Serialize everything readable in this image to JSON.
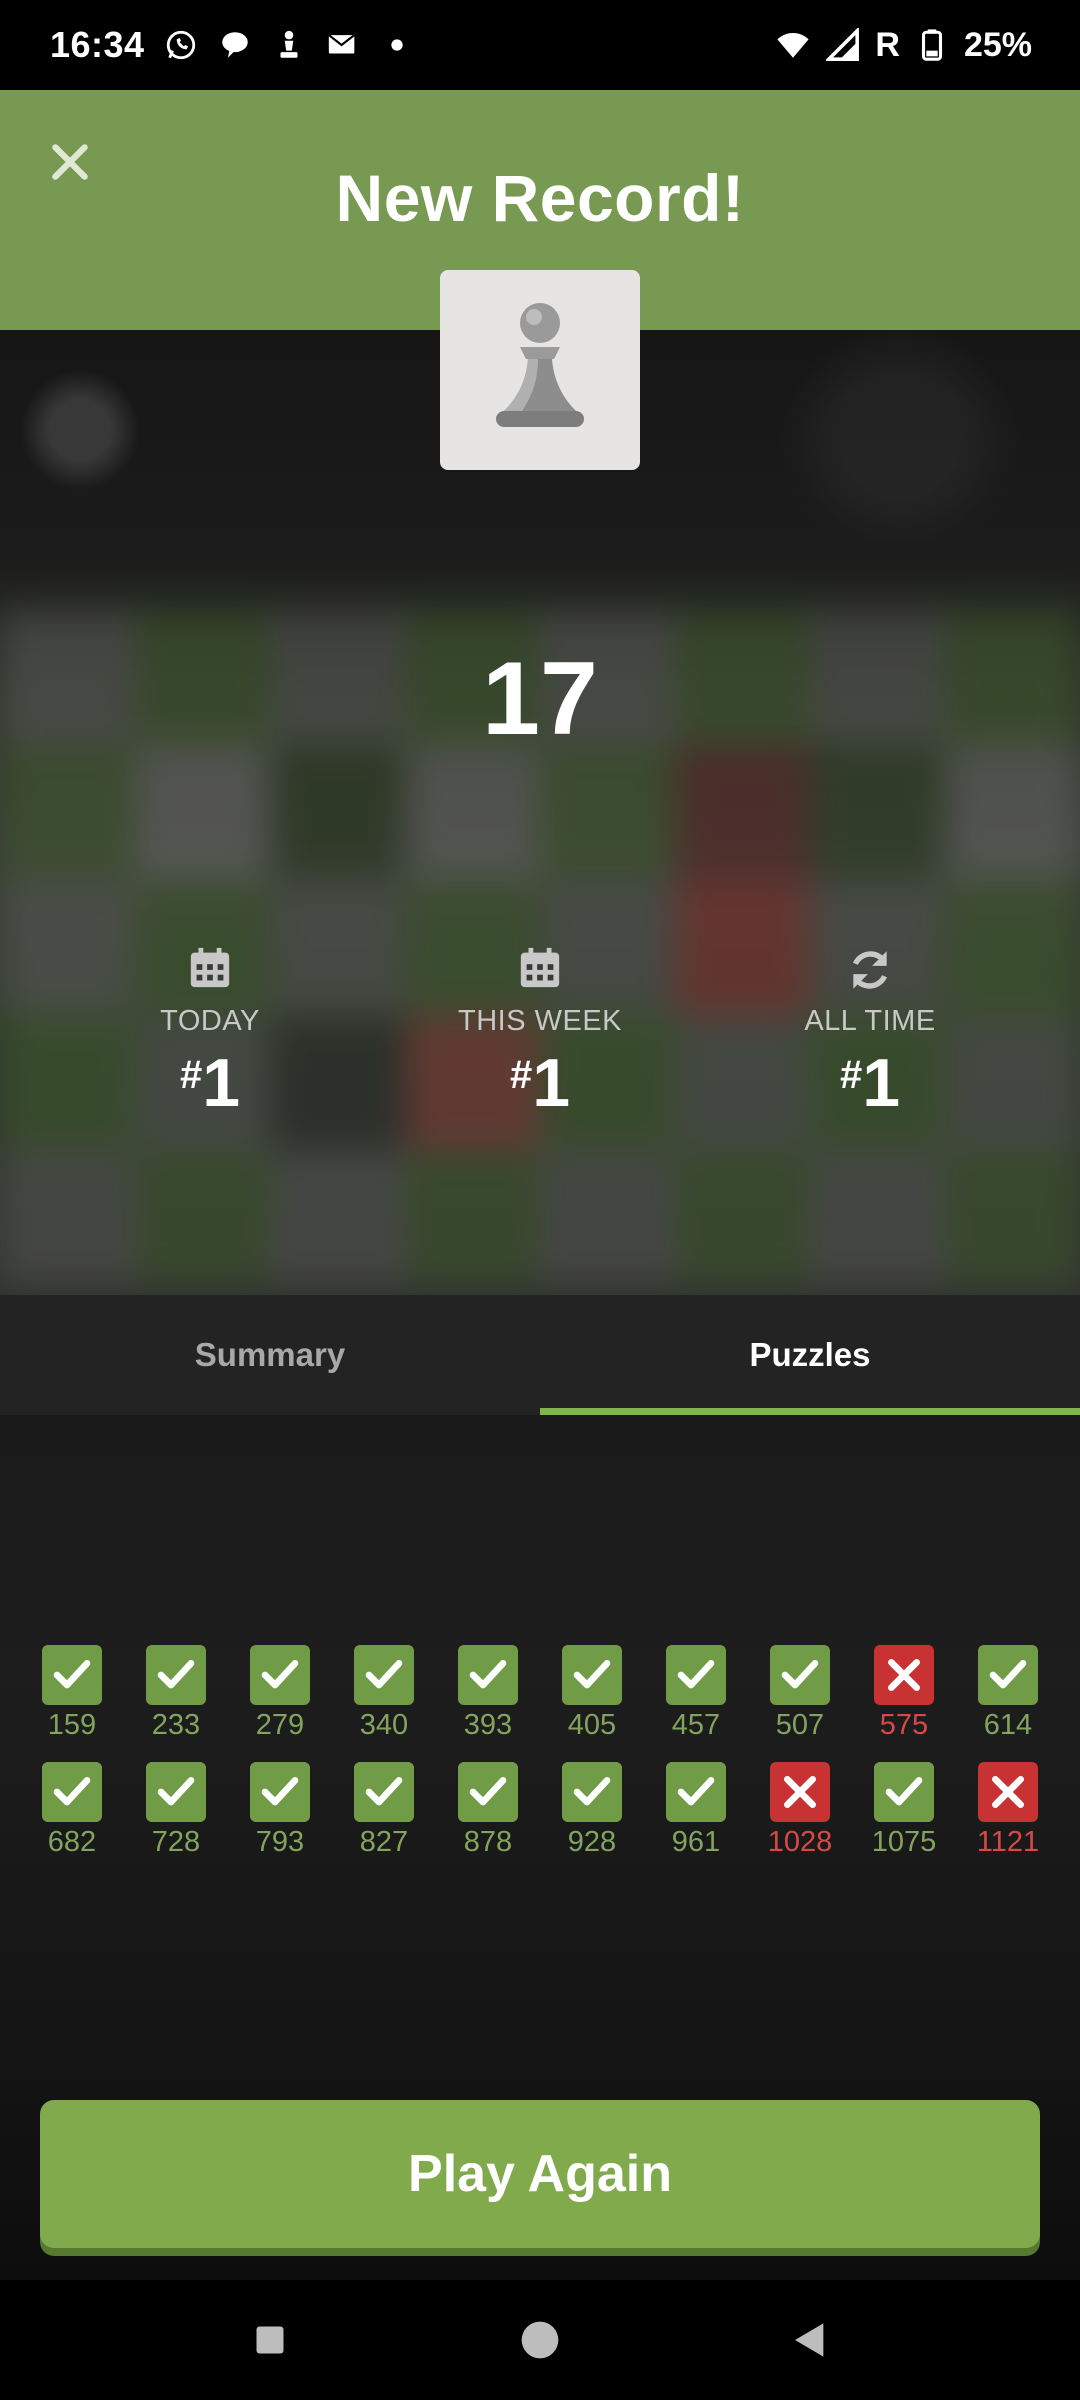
{
  "status_bar": {
    "time": "16:34",
    "carrier_letter": "R",
    "battery": "25%",
    "icons": [
      "whatsapp-icon",
      "chat-icon",
      "chess-icon",
      "mail-icon",
      "dot-icon",
      "wifi-icon",
      "signal-icon",
      "battery-icon"
    ]
  },
  "header": {
    "title": "New Record!",
    "close_icon": "close-icon",
    "avatar_icon": "pawn-icon"
  },
  "score": "17",
  "ranks": [
    {
      "icon": "calendar-icon",
      "label": "TODAY",
      "hash": "#",
      "value": "1"
    },
    {
      "icon": "calendar-icon",
      "label": "THIS WEEK",
      "hash": "#",
      "value": "1"
    },
    {
      "icon": "refresh-icon",
      "label": "ALL TIME",
      "hash": "#",
      "value": "1"
    }
  ],
  "tabs": [
    {
      "label": "Summary",
      "active": false
    },
    {
      "label": "Puzzles",
      "active": true
    }
  ],
  "puzzles": [
    {
      "rating": "159",
      "result": "ok"
    },
    {
      "rating": "233",
      "result": "ok"
    },
    {
      "rating": "279",
      "result": "ok"
    },
    {
      "rating": "340",
      "result": "ok"
    },
    {
      "rating": "393",
      "result": "ok"
    },
    {
      "rating": "405",
      "result": "ok"
    },
    {
      "rating": "457",
      "result": "ok"
    },
    {
      "rating": "507",
      "result": "ok"
    },
    {
      "rating": "575",
      "result": "fail"
    },
    {
      "rating": "614",
      "result": "ok"
    },
    {
      "rating": "682",
      "result": "ok"
    },
    {
      "rating": "728",
      "result": "ok"
    },
    {
      "rating": "793",
      "result": "ok"
    },
    {
      "rating": "827",
      "result": "ok"
    },
    {
      "rating": "878",
      "result": "ok"
    },
    {
      "rating": "928",
      "result": "ok"
    },
    {
      "rating": "961",
      "result": "ok"
    },
    {
      "rating": "1028",
      "result": "fail"
    },
    {
      "rating": "1075",
      "result": "ok"
    },
    {
      "rating": "1121",
      "result": "fail"
    }
  ],
  "play_button": "Play Again",
  "colors": {
    "header_green": "#779952",
    "button_green": "#81aa4d",
    "success": "#709b47",
    "fail": "#c83232",
    "tab_indicator": "#81b64c"
  },
  "nav": [
    "recents-icon",
    "home-icon",
    "back-icon"
  ]
}
